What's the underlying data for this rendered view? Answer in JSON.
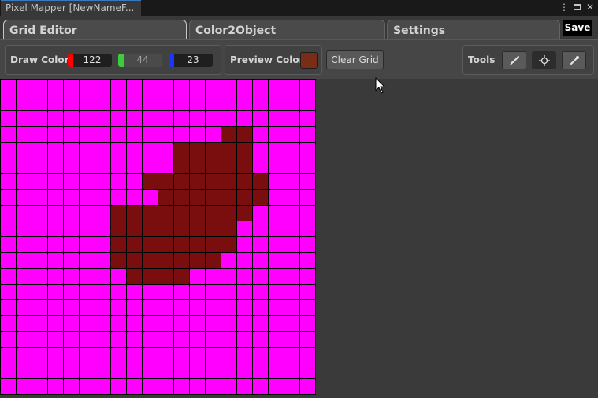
{
  "window": {
    "title": "Pixel Mapper [NewNameF...",
    "menu_icon": "kebab-icon",
    "maximize_icon": "maximize-icon",
    "close_icon": "close-icon"
  },
  "tabs": [
    {
      "label": "Grid Editor",
      "active": true
    },
    {
      "label": "Color2Object",
      "active": false
    },
    {
      "label": "Settings",
      "active": false
    }
  ],
  "save_label": "Save",
  "draw_color": {
    "label": "Draw Color",
    "r": "122",
    "g": "44",
    "b": "23",
    "r_color": "#ff0000",
    "g_color": "#3ccc3c",
    "b_color": "#1c36ff"
  },
  "preview_color": {
    "label": "Preview Color",
    "swatch": "#7a2c17"
  },
  "clear_grid_label": "Clear Grid",
  "tools": {
    "label": "Tools",
    "items": [
      {
        "icon": "brush-icon",
        "selected": false
      },
      {
        "icon": "crosshair-icon",
        "selected": true
      },
      {
        "icon": "eyedropper-icon",
        "selected": false
      }
    ]
  },
  "grid": {
    "columns": 20,
    "rows": 20,
    "background_color": "#ff00ff",
    "paint_color": "#7a0d0d",
    "painted_cells": [
      [
        3,
        14
      ],
      [
        3,
        15
      ],
      [
        4,
        11
      ],
      [
        4,
        12
      ],
      [
        4,
        13
      ],
      [
        4,
        14
      ],
      [
        4,
        15
      ],
      [
        5,
        11
      ],
      [
        5,
        12
      ],
      [
        5,
        13
      ],
      [
        5,
        14
      ],
      [
        5,
        15
      ],
      [
        6,
        9
      ],
      [
        6,
        10
      ],
      [
        6,
        11
      ],
      [
        6,
        12
      ],
      [
        6,
        13
      ],
      [
        6,
        14
      ],
      [
        6,
        15
      ],
      [
        6,
        16
      ],
      [
        7,
        10
      ],
      [
        7,
        11
      ],
      [
        7,
        12
      ],
      [
        7,
        13
      ],
      [
        7,
        14
      ],
      [
        7,
        15
      ],
      [
        7,
        16
      ],
      [
        8,
        7
      ],
      [
        8,
        8
      ],
      [
        8,
        9
      ],
      [
        8,
        10
      ],
      [
        8,
        11
      ],
      [
        8,
        12
      ],
      [
        8,
        13
      ],
      [
        8,
        14
      ],
      [
        8,
        15
      ],
      [
        9,
        7
      ],
      [
        9,
        8
      ],
      [
        9,
        9
      ],
      [
        9,
        10
      ],
      [
        9,
        11
      ],
      [
        9,
        12
      ],
      [
        9,
        13
      ],
      [
        9,
        14
      ],
      [
        10,
        7
      ],
      [
        10,
        8
      ],
      [
        10,
        9
      ],
      [
        10,
        10
      ],
      [
        10,
        11
      ],
      [
        10,
        12
      ],
      [
        10,
        13
      ],
      [
        10,
        14
      ],
      [
        11,
        7
      ],
      [
        11,
        8
      ],
      [
        11,
        9
      ],
      [
        11,
        10
      ],
      [
        11,
        11
      ],
      [
        11,
        12
      ],
      [
        11,
        13
      ],
      [
        12,
        8
      ],
      [
        12,
        9
      ],
      [
        12,
        10
      ],
      [
        12,
        11
      ]
    ]
  }
}
